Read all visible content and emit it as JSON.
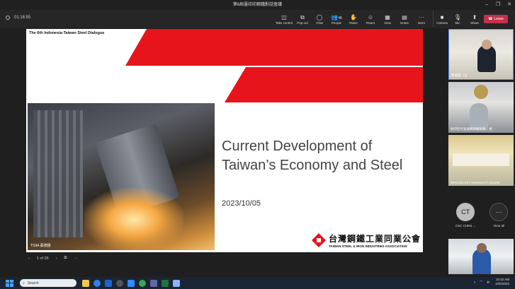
{
  "window": {
    "title": "第6屆臺印印鋼鐵對話會議",
    "min": "–",
    "max": "❐",
    "close": "✕"
  },
  "toolbar": {
    "timer": "01:16:55",
    "tools": [
      {
        "icon": "◫",
        "label": "Take control"
      },
      {
        "icon": "⧉",
        "label": "Pop out"
      },
      {
        "icon": "◯",
        "label": "Chat"
      },
      {
        "icon": "👥",
        "label": "People",
        "badge": "48"
      },
      {
        "icon": "✋",
        "label": "Raise"
      },
      {
        "icon": "☺",
        "label": "React"
      },
      {
        "icon": "▦",
        "label": "View"
      },
      {
        "icon": "▤",
        "label": "Notes"
      },
      {
        "icon": "···",
        "label": "More"
      }
    ],
    "camera_label": "Camera",
    "mic_label": "Mic",
    "share_label": "Share",
    "leave_label": "Leave"
  },
  "slide": {
    "header": "The 6th Indonesia-Taiwan Steel Dialogue",
    "title_line1": "Current Development of",
    "title_line2": "Taiwan’s Economy and Steel",
    "date": "2023/10/05",
    "photo_label": "TSIIA 蔡德揚",
    "logo_zh": "台灣鋼鐵工業同業公會",
    "logo_en": "TAIWAN STEEL & IRON INDUSTRIES ASSOCIATION",
    "accent_color": "#e8141c"
  },
  "slide_nav": {
    "page": "1 of 26"
  },
  "participants": {
    "tile1_label": "蔡德揚（主",
    "tile2_label": "駐印尼代表處經濟組長黃... 經...",
    "tile3_label": "BROADCAST ARAHDUTA (Guest)",
    "ct_initials": "CT",
    "ct_label": "CSC CHEN ...",
    "view_all_label": "View all"
  },
  "taskbar": {
    "search_placeholder": "Search",
    "time": "10:42 AM",
    "date": "10/5/2023"
  }
}
